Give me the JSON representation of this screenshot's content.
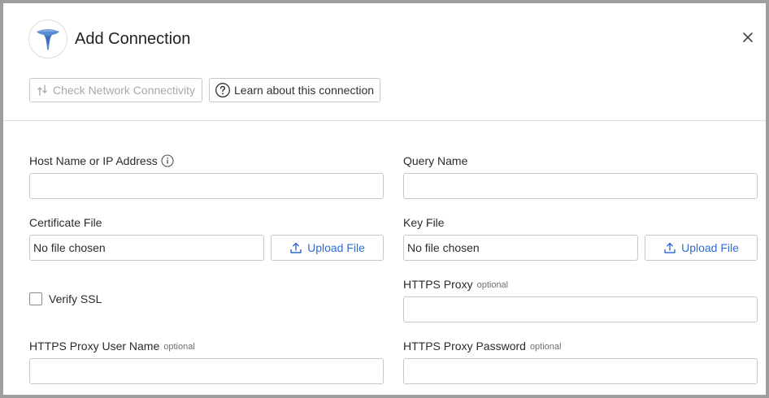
{
  "dialog": {
    "title": "Add Connection",
    "logo_icon": "triangle-brand-logo",
    "close_icon": "close-icon",
    "brand_color": "#5b8bd1"
  },
  "toolbar": {
    "check_network_label": "Check Network Connectivity",
    "learn_label": "Learn about this connection"
  },
  "form": {
    "host": {
      "label": "Host Name or IP Address",
      "value": ""
    },
    "query_name": {
      "label": "Query Name",
      "value": ""
    },
    "certificate_file": {
      "label": "Certificate File",
      "status": "No file chosen",
      "upload_label": "Upload File"
    },
    "key_file": {
      "label": "Key File",
      "status": "No file chosen",
      "upload_label": "Upload File"
    },
    "verify_ssl": {
      "label": "Verify SSL",
      "checked": false
    },
    "https_proxy": {
      "label": "HTTPS Proxy",
      "optional": "optional",
      "value": ""
    },
    "https_proxy_user": {
      "label": "HTTPS Proxy User Name",
      "optional": "optional",
      "value": ""
    },
    "https_proxy_password": {
      "label": "HTTPS Proxy Password",
      "optional": "optional",
      "value": ""
    }
  },
  "colors": {
    "accent": "#2f6bd1",
    "disabled_text": "#a8a8a8",
    "border": "#c8c8c8"
  }
}
